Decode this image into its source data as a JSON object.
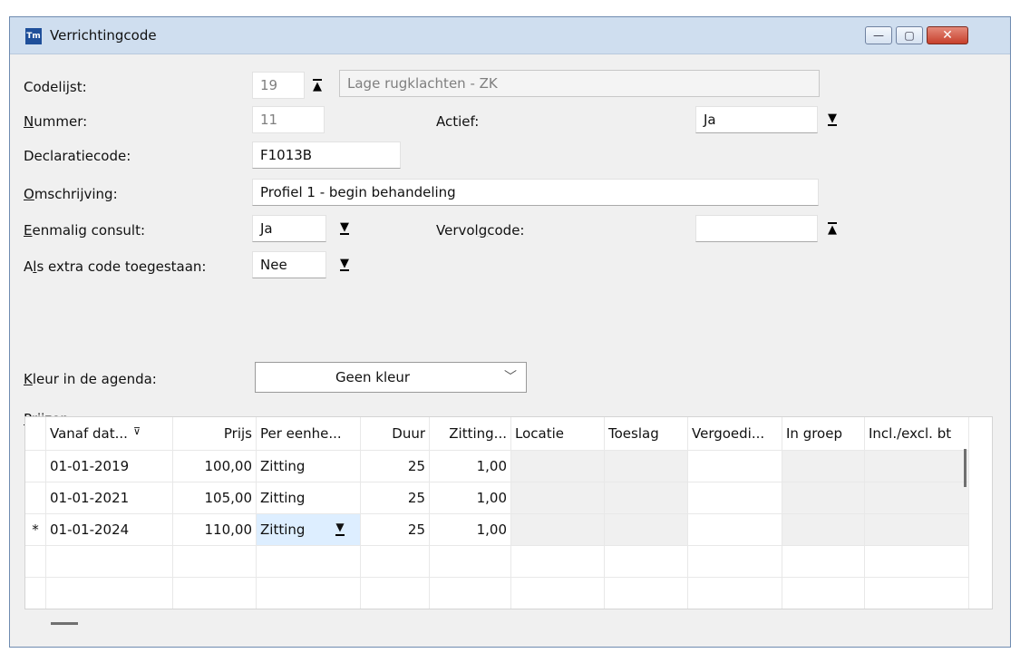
{
  "window": {
    "title": "Verrichtingcode",
    "icon_label": "Tm",
    "buttons": {
      "minimize": "—",
      "maximize": "▢",
      "close": "✕"
    }
  },
  "form": {
    "codelijst": {
      "label": "Codelijst:",
      "value": "19",
      "description": "Lage rugklachten - ZK"
    },
    "nummer": {
      "label_u": "N",
      "label_rest": "ummer:",
      "value": "11"
    },
    "actief": {
      "label": "Actief:",
      "value": "Ja"
    },
    "declaratiecode": {
      "label": "Declaratiecode:",
      "value": "F1013B"
    },
    "omschrijving": {
      "label_u": "O",
      "label_rest": "mschrijving:",
      "value": "Profiel 1 - begin behandeling"
    },
    "eenmalig_consult": {
      "label_u": "E",
      "label_rest": "enmalig consult:",
      "value": "Ja"
    },
    "vervolgcode": {
      "label_pre": "Vervol",
      "label_u": "g",
      "label_rest": "code:",
      "value": ""
    },
    "extra_code": {
      "label_pre": "A",
      "label_u": "l",
      "label_rest": "s extra code toegestaan:",
      "value": "Nee"
    },
    "kleur": {
      "label_u": "K",
      "label_rest": "leur in de agenda:",
      "value": "Geen kleur"
    },
    "prijzen": {
      "label_u": "P",
      "label_rest": "rijzen:"
    }
  },
  "grid": {
    "columns": [
      "Vanaf dat...",
      "Prijs",
      "Per eenhe...",
      "Duur",
      "Zitting...",
      "Locatie",
      "Toeslag",
      "Vergoedi...",
      "In groep",
      "Incl./excl. bt"
    ],
    "rows": [
      {
        "marker": "",
        "vanaf": "01-01-2019",
        "prijs": "100,00",
        "eenheid": "Zitting",
        "duur": "25",
        "zitting": "1,00"
      },
      {
        "marker": "",
        "vanaf": "01-01-2021",
        "prijs": "105,00",
        "eenheid": "Zitting",
        "duur": "25",
        "zitting": "1,00"
      },
      {
        "marker": "*",
        "vanaf": "01-01-2024",
        "prijs": "110,00",
        "eenheid": "Zitting",
        "duur": "25",
        "zitting": "1,00"
      }
    ]
  },
  "icons": {
    "up_arrow": "up-arrow-icon",
    "down_arrow": "down-arrow-icon",
    "chevron": "chevron-down-icon",
    "sort": "sort-filter-icon"
  }
}
